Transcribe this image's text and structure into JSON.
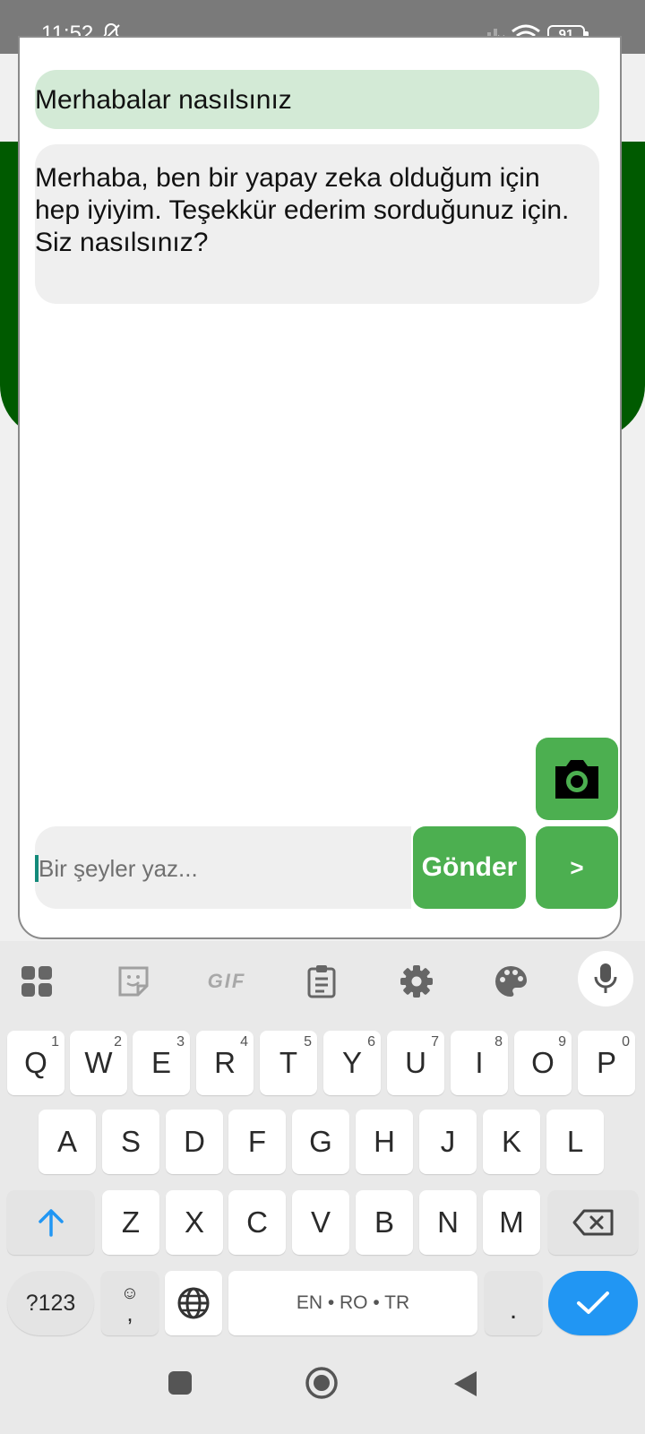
{
  "status_bar": {
    "time": "11:52",
    "battery": "91",
    "icons": [
      "bell-off-icon",
      "signal-off-icon",
      "wifi-icon",
      "battery-icon"
    ]
  },
  "chat": {
    "messages": [
      {
        "role": "user",
        "text": "Merhabalar nasılsınız"
      },
      {
        "role": "assistant",
        "text": "Merhaba, ben bir yapay zeka olduğum için hep iyiyim. Teşekkür ederim sorduğunuz için. Siz nasılsınız?"
      }
    ],
    "input_placeholder": "Bir şeyler yaz...",
    "input_value": "",
    "send_label": "Gönder",
    "next_label": ">",
    "camera_icon": "camera-icon"
  },
  "colors": {
    "accent_green": "#4caf50",
    "header_green": "#005a00",
    "user_bubble": "#d3ead6",
    "assistant_bubble": "#efefef",
    "enter_key": "#2196f3"
  },
  "keyboard": {
    "toolbar_icons": [
      "apps-grid-icon",
      "sticker-icon",
      "gif-icon",
      "clipboard-icon",
      "settings-icon",
      "palette-icon",
      "microphone-icon"
    ],
    "gif_label": "GIF",
    "row1": [
      {
        "label": "Q",
        "hint": "1"
      },
      {
        "label": "W",
        "hint": "2"
      },
      {
        "label": "E",
        "hint": "3"
      },
      {
        "label": "R",
        "hint": "4"
      },
      {
        "label": "T",
        "hint": "5"
      },
      {
        "label": "Y",
        "hint": "6"
      },
      {
        "label": "U",
        "hint": "7"
      },
      {
        "label": "I",
        "hint": "8"
      },
      {
        "label": "O",
        "hint": "9"
      },
      {
        "label": "P",
        "hint": "0"
      }
    ],
    "row2": [
      "A",
      "S",
      "D",
      "F",
      "G",
      "H",
      "J",
      "K",
      "L"
    ],
    "row3": [
      "Z",
      "X",
      "C",
      "V",
      "B",
      "N",
      "M"
    ],
    "mode_label": "?123",
    "emoji_symbol": "☺",
    "comma_label": ",",
    "space_label": "EN • RO • TR",
    "period_label": ".",
    "shift_icon": "shift-arrow-icon",
    "backspace_icon": "backspace-icon",
    "globe_icon": "globe-icon",
    "enter_icon": "checkmark-icon"
  },
  "nav_bar": {
    "icons": [
      "recent-apps-icon",
      "home-icon",
      "back-icon"
    ]
  }
}
